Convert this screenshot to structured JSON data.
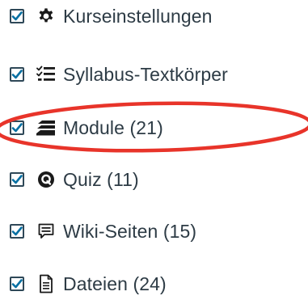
{
  "options": [
    {
      "label": "Kurseinstellungen",
      "icon": "gear-icon",
      "checked": true
    },
    {
      "label": "Syllabus-Textkörper",
      "icon": "checklist-icon",
      "checked": true
    },
    {
      "label": "Module (21)",
      "icon": "stack-layers-icon",
      "checked": true
    },
    {
      "label": "Quiz (11)",
      "icon": "quiz-icon",
      "checked": true
    },
    {
      "label": "Wiki-Seiten (15)",
      "icon": "wiki-page-icon",
      "checked": true
    },
    {
      "label": "Dateien (24)",
      "icon": "document-icon",
      "checked": true
    }
  ],
  "colors": {
    "text": "#2d3b45",
    "checkbox_border": "#2f4858",
    "checkmark": "#0770a3",
    "highlight": "#e8342a"
  }
}
